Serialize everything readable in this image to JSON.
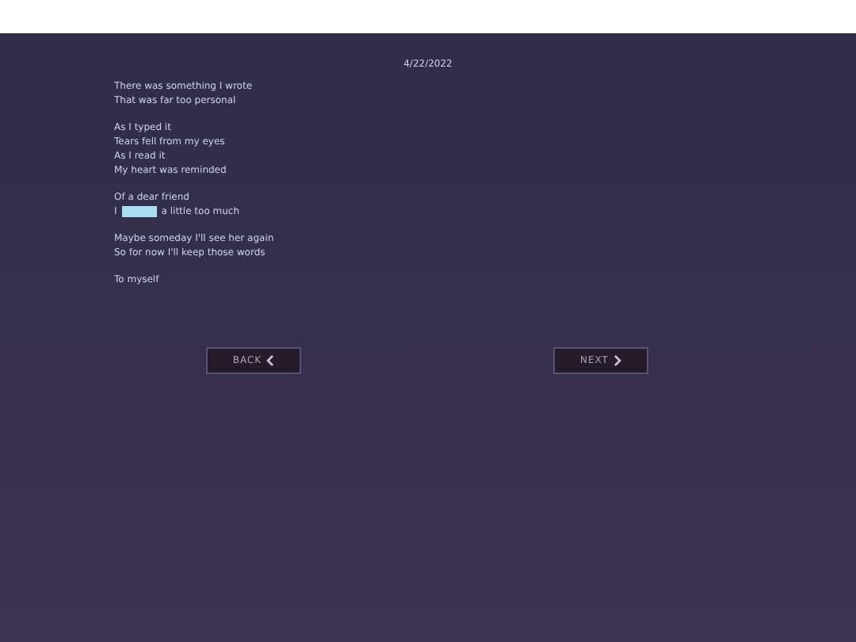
{
  "date": "4/22/2022",
  "stanzas": [
    [
      {
        "kind": "text",
        "text": "There was something I wrote"
      },
      {
        "kind": "text",
        "text": "That was far too personal"
      }
    ],
    [
      {
        "kind": "text",
        "text": "As I typed it"
      },
      {
        "kind": "text",
        "text": "Tears fell from my eyes"
      },
      {
        "kind": "text",
        "text": "As I read it"
      },
      {
        "kind": "text",
        "text": "My heart was reminded"
      }
    ],
    [
      {
        "kind": "text",
        "text": "Of a dear friend"
      },
      {
        "kind": "blank",
        "before": "I",
        "after": "a little too much"
      }
    ],
    [
      {
        "kind": "text",
        "text": "Maybe someday I'll see her again"
      },
      {
        "kind": "text",
        "text": "So for now I'll keep those words"
      }
    ],
    [
      {
        "kind": "text",
        "text": "To myself"
      }
    ]
  ],
  "buttons": [
    {
      "label": "BACK",
      "kind": "back"
    },
    {
      "label": "NEXT",
      "kind": "next"
    }
  ]
}
